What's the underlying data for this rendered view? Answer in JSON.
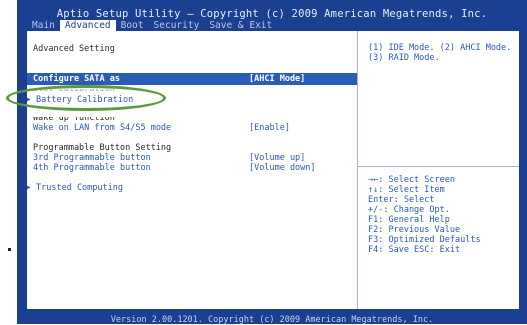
{
  "window": {
    "title": "Aptio Setup Utility – Copyright (c) 2009 American Megatrends, Inc.",
    "footer": "Version 2.00.1201. Copyright (c) 2009 American Megatrends, Inc."
  },
  "tabs": [
    {
      "label": "Main"
    },
    {
      "label": "Advanced",
      "active": true
    },
    {
      "label": "Boot"
    },
    {
      "label": "Security"
    },
    {
      "label": "Save & Exit"
    }
  ],
  "main": {
    "heading": "Advanced Setting",
    "sata": {
      "label": "Configure SATA as",
      "value": "[AHCI Mode]"
    },
    "hidden_label": "Slot Calibration",
    "battery": {
      "label": "Battery Calibration"
    },
    "wake_header": "Wake up function",
    "wol": {
      "label": "Wake on LAN from S4/S5 mode",
      "value": "[Enable]"
    },
    "pb_header": "Programmable Button Setting",
    "pb3": {
      "label": "3rd Programmable button",
      "value": "[Volume up]"
    },
    "pb4": {
      "label": "4th Programmable button",
      "value": "[Volume down]"
    },
    "trusted": {
      "label": "Trusted Computing"
    },
    "submenu_marker": "▶"
  },
  "help": {
    "description": "(1) IDE Mode. (2) AHCI Mode.\n(3) RAID Mode.",
    "keys": [
      "→←: Select Screen",
      "↑↓: Select Item",
      "Enter: Select",
      "+/-: Change Opt.",
      "F1: General Help",
      "F2: Previous Value",
      "F3: Optimized Defaults",
      "F4: Save  ESC: Exit"
    ]
  },
  "colors": {
    "background": "#1b3f91",
    "panel": "#ffffff",
    "text_blue": "#2b59b8",
    "highlight": "#2b5db8",
    "annotation_oval": "#5a9b3a"
  }
}
